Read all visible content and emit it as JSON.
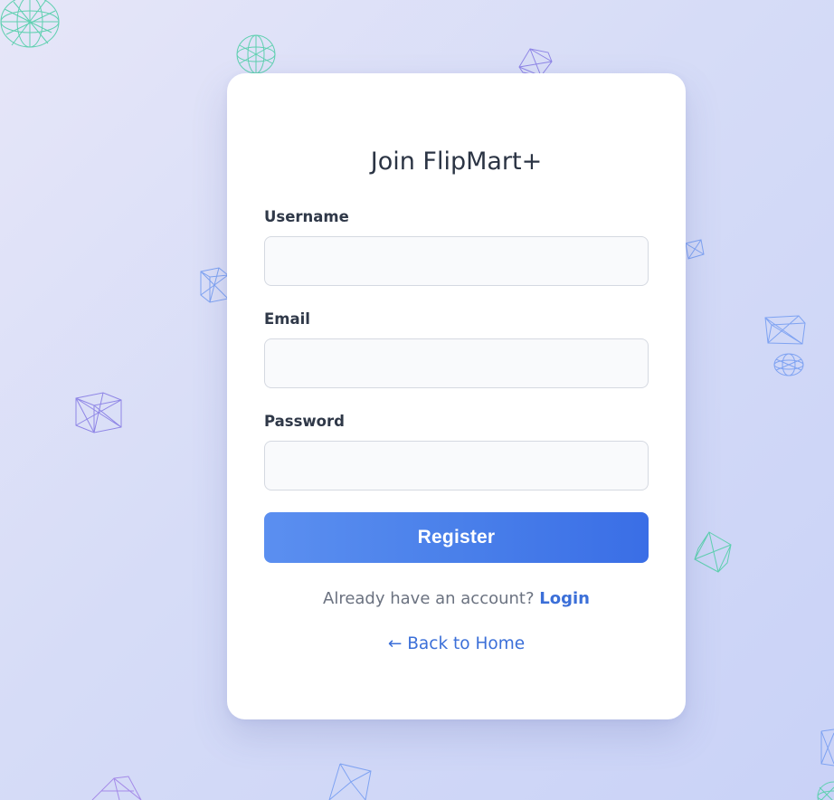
{
  "form": {
    "title": "Join FlipMart+",
    "username_label": "Username",
    "username_value": "",
    "email_label": "Email",
    "email_value": "",
    "password_label": "Password",
    "password_value": "",
    "register_label": "Register"
  },
  "footer": {
    "account_prompt": "Already have an account?",
    "login_label": "Login",
    "back_label": "← Back to Home"
  },
  "colors": {
    "accent": "#3b6fd8",
    "button_start": "#5b8ff0",
    "button_end": "#3a6ee6",
    "background": "#d6dcf7"
  },
  "icons": {
    "decorations": [
      "wireframe-sphere-icon",
      "wireframe-cube-icon",
      "wireframe-octahedron-icon"
    ]
  }
}
